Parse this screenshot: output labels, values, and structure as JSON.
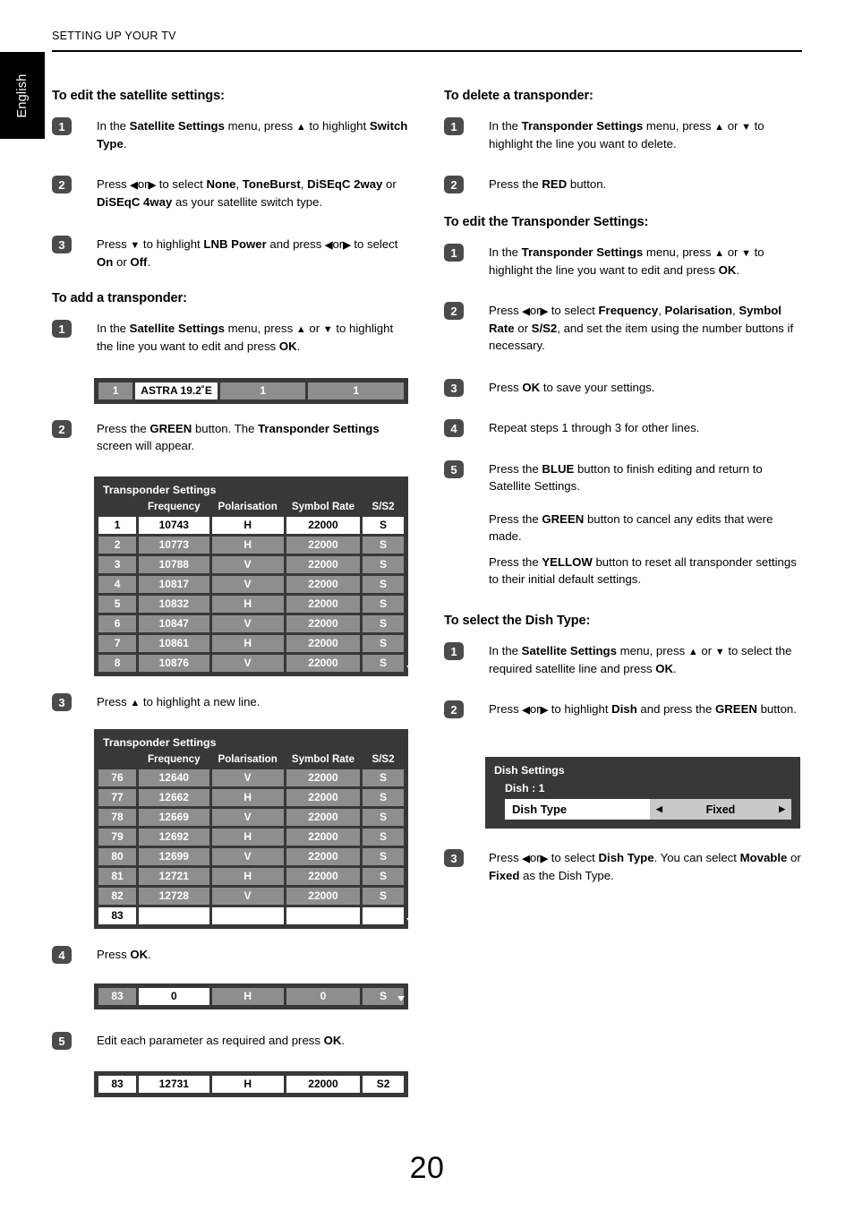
{
  "header": {
    "title": "SETTING UP YOUR TV",
    "language_tab": "English"
  },
  "page_number": "20",
  "icons": {
    "up": "▲",
    "down": "▼",
    "left": "◀",
    "right": "▶",
    "scroll_down": "scroll-down-arrow"
  },
  "left_column": {
    "section1": {
      "heading": "To edit the satellite settings:",
      "steps": [
        {
          "num": "1",
          "html": "In the <b>Satellite Settings</b> menu, press <b class=\"ar\">▲</b> to highlight <b>Switch Type</b>."
        },
        {
          "num": "2",
          "html": "Press <b class=\"ar\">◀</b>or<b class=\"ar\">▶</b> to select <b>None</b>, <b>ToneBurst</b>, <b>DiSEqC 2way</b> or <b>DiSEqC 4way</b> as your satellite switch type."
        },
        {
          "num": "3",
          "html": "Press <b class=\"ar\">▼</b> to highlight <b>LNB Power</b> and press <b class=\"ar\">◀</b>or<b class=\"ar\">▶</b> to select <b>On</b> or <b>Off</b>."
        }
      ]
    },
    "section2": {
      "heading": "To add a transponder:",
      "step1": {
        "num": "1",
        "html": "In the <b>Satellite Settings</b> menu, press <b class=\"ar\">▲</b> or <b class=\"ar\">▼</b> to highlight the line you want to edit and press <b>OK</b>."
      },
      "step2": {
        "num": "2",
        "html": "Press the <b>GREEN</b> button. The <b>Transponder Settings</b> screen will appear."
      },
      "step3": {
        "num": "3",
        "html": "Press <b class=\"ar\">▲</b> to highlight a new line."
      },
      "step4": {
        "num": "4",
        "html": "Press <b>OK</b>."
      },
      "step5": {
        "num": "5",
        "html": "Edit each parameter as required and press <b>OK</b>."
      }
    }
  },
  "right_column": {
    "section3": {
      "heading": "To delete a transponder:",
      "steps": [
        {
          "num": "1",
          "html": "In the <b>Transponder Settings</b> menu, press <b class=\"ar\">▲</b> or <b class=\"ar\">▼</b> to highlight the line you want to delete."
        },
        {
          "num": "2",
          "html": "Press the <b>RED</b> button."
        }
      ]
    },
    "section4": {
      "heading": "To edit the Transponder Settings:",
      "steps": [
        {
          "num": "1",
          "html": "In the <b>Transponder Settings</b> menu, press <b class=\"ar\">▲</b> or <b class=\"ar\">▼</b> to highlight the line you want to edit and press <b>OK</b>."
        },
        {
          "num": "2",
          "html": "Press <b class=\"ar\">◀</b>or<b class=\"ar\">▶</b> to select <b>Frequency</b>, <b>Polarisation</b>, <b>Symbol Rate</b> or <b>S/S2</b>, and set the item using the number buttons if necessary."
        },
        {
          "num": "3",
          "html": "Press <b>OK</b> to save your settings."
        },
        {
          "num": "4",
          "html": "Repeat steps 1 through 3 for other lines."
        },
        {
          "num": "5",
          "html": "Press the <b>BLUE</b> button to finish editing and return to Satellite Settings."
        }
      ],
      "extra_paragraphs": [
        "Press the <b>GREEN</b> button to cancel any edits that were made.",
        "Press the <b>YELLOW</b> button to reset all transponder settings to their initial default settings."
      ]
    },
    "section5": {
      "heading": "To select the Dish Type:",
      "steps": [
        {
          "num": "1",
          "html": "In the <b>Satellite Settings</b> menu, press <b class=\"ar\">▲</b> or <b class=\"ar\">▼</b> to select the required satellite line and press <b>OK</b>."
        },
        {
          "num": "2",
          "html": "Press <b class=\"ar\">◀</b>or<b class=\"ar\">▶</b> to highlight <b>Dish</b> and press the <b>GREEN</b> button."
        },
        {
          "num": "3",
          "html": "Press <b class=\"ar\">◀</b>or<b class=\"ar\">▶</b> to select <b>Dish Type</b>. You can select <b>Movable</b> or <b>Fixed</b> as the Dish Type."
        }
      ]
    }
  },
  "osd": {
    "satellite_strip": {
      "cells": [
        {
          "text": "1",
          "style": "g"
        },
        {
          "text": "ASTRA 19.2˚E",
          "style": "w"
        },
        {
          "text": "1",
          "style": "g"
        },
        {
          "text": "1",
          "style": "g"
        }
      ]
    },
    "transponder_table_1": {
      "title": "Transponder Settings",
      "headers": [
        "",
        "Frequency",
        "Polarisation",
        "Symbol Rate",
        "S/S2"
      ],
      "rows": [
        {
          "cells": [
            "1",
            "10743",
            "H",
            "22000",
            "S"
          ],
          "style": "w"
        },
        {
          "cells": [
            "2",
            "10773",
            "H",
            "22000",
            "S"
          ],
          "style": "g"
        },
        {
          "cells": [
            "3",
            "10788",
            "V",
            "22000",
            "S"
          ],
          "style": "g"
        },
        {
          "cells": [
            "4",
            "10817",
            "V",
            "22000",
            "S"
          ],
          "style": "g"
        },
        {
          "cells": [
            "5",
            "10832",
            "H",
            "22000",
            "S"
          ],
          "style": "g"
        },
        {
          "cells": [
            "6",
            "10847",
            "V",
            "22000",
            "S"
          ],
          "style": "g"
        },
        {
          "cells": [
            "7",
            "10861",
            "H",
            "22000",
            "S"
          ],
          "style": "g"
        },
        {
          "cells": [
            "8",
            "10876",
            "V",
            "22000",
            "S"
          ],
          "style": "g"
        }
      ]
    },
    "transponder_table_2": {
      "title": "Transponder Settings",
      "headers": [
        "",
        "Frequency",
        "Polarisation",
        "Symbol Rate",
        "S/S2"
      ],
      "rows": [
        {
          "cells": [
            "76",
            "12640",
            "V",
            "22000",
            "S"
          ],
          "style": "g"
        },
        {
          "cells": [
            "77",
            "12662",
            "H",
            "22000",
            "S"
          ],
          "style": "g"
        },
        {
          "cells": [
            "78",
            "12669",
            "V",
            "22000",
            "S"
          ],
          "style": "g"
        },
        {
          "cells": [
            "79",
            "12692",
            "H",
            "22000",
            "S"
          ],
          "style": "g"
        },
        {
          "cells": [
            "80",
            "12699",
            "V",
            "22000",
            "S"
          ],
          "style": "g"
        },
        {
          "cells": [
            "81",
            "12721",
            "H",
            "22000",
            "S"
          ],
          "style": "g"
        },
        {
          "cells": [
            "82",
            "12728",
            "V",
            "22000",
            "S"
          ],
          "style": "g"
        },
        {
          "cells": [
            "83",
            "",
            "",
            "",
            ""
          ],
          "style": "w"
        }
      ]
    },
    "strip_blank": {
      "cells": [
        {
          "text": "83",
          "style": "g"
        },
        {
          "text": "0",
          "style": "w"
        },
        {
          "text": "H",
          "style": "g"
        },
        {
          "text": "0",
          "style": "g"
        },
        {
          "text": "S",
          "style": "g"
        }
      ]
    },
    "strip_filled": {
      "cells": [
        {
          "text": "83",
          "style": "w"
        },
        {
          "text": "12731",
          "style": "w"
        },
        {
          "text": "H",
          "style": "w"
        },
        {
          "text": "22000",
          "style": "w"
        },
        {
          "text": "S2",
          "style": "w"
        }
      ]
    },
    "dish_settings": {
      "title": "Dish Settings",
      "dish_line": "Dish : 1",
      "row_label": "Dish Type",
      "row_value": "Fixed",
      "left_arrow": "◀",
      "right_arrow": "▶"
    }
  },
  "colors": {
    "osd_background": "#383838",
    "osd_cell_gray": "#8e8e8e",
    "osd_cell_white": "#ffffff",
    "badge": "#4b4b4b",
    "tab_black": "#000000",
    "dish_value_gray": "#c9c9c9"
  }
}
